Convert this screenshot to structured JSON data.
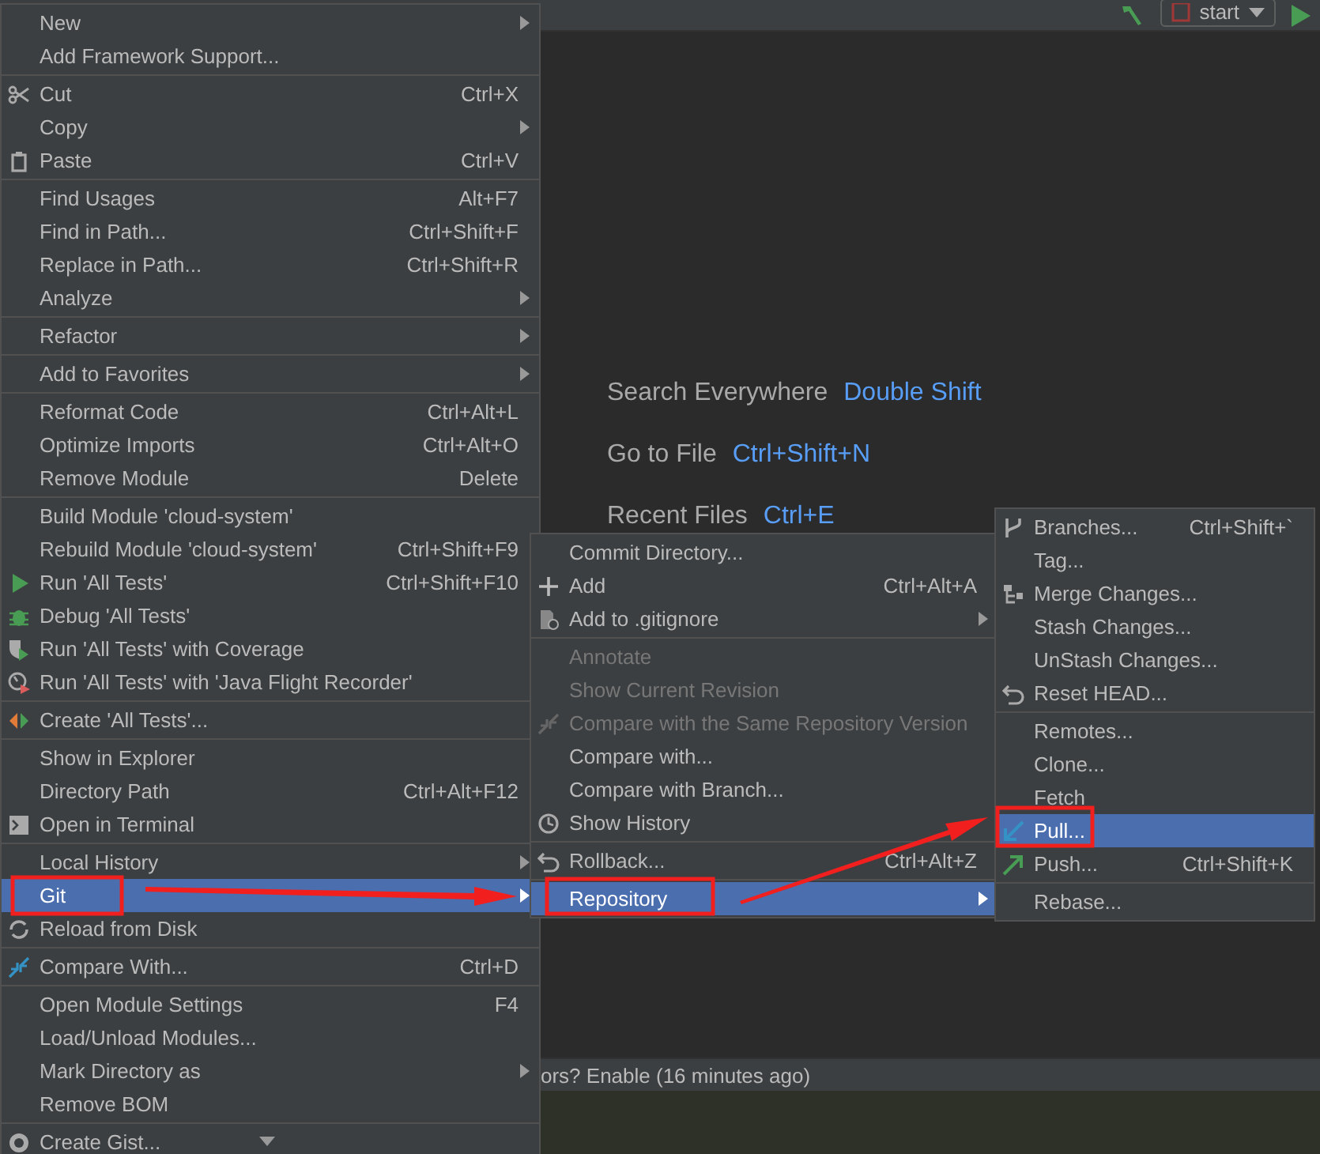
{
  "toolbar": {
    "run_configuration": "start"
  },
  "editor_hints": [
    {
      "action": "Search Everywhere",
      "shortcut": "Double Shift"
    },
    {
      "action": "Go to File",
      "shortcut": "Ctrl+Shift+N"
    },
    {
      "action": "Recent Files",
      "shortcut": "Ctrl+E"
    }
  ],
  "status_bar": {
    "text": "ors? Enable (16 minutes ago)"
  },
  "menus": [
    {
      "sections": [
        [
          {
            "label": "New",
            "submenu": true,
            "selected": false,
            "disabled": false
          },
          {
            "label": "Add Framework Support...",
            "submenu": false,
            "selected": false,
            "disabled": false
          }
        ],
        [
          {
            "label": "Cut",
            "shortcut": "Ctrl+X",
            "submenu": false,
            "selected": false,
            "disabled": false
          },
          {
            "label": "Copy",
            "submenu": true,
            "selected": false,
            "disabled": false
          },
          {
            "label": "Paste",
            "shortcut": "Ctrl+V",
            "submenu": false,
            "selected": false,
            "disabled": false
          }
        ],
        [
          {
            "label": "Find Usages",
            "shortcut": "Alt+F7",
            "submenu": false,
            "selected": false,
            "disabled": false
          },
          {
            "label": "Find in Path...",
            "shortcut": "Ctrl+Shift+F",
            "submenu": false,
            "selected": false,
            "disabled": false
          },
          {
            "label": "Replace in Path...",
            "shortcut": "Ctrl+Shift+R",
            "submenu": false,
            "selected": false,
            "disabled": false
          },
          {
            "label": "Analyze",
            "submenu": true,
            "selected": false,
            "disabled": false
          }
        ],
        [
          {
            "label": "Refactor",
            "submenu": true,
            "selected": false,
            "disabled": false
          }
        ],
        [
          {
            "label": "Add to Favorites",
            "submenu": true,
            "selected": false,
            "disabled": false
          }
        ],
        [
          {
            "label": "Reformat Code",
            "shortcut": "Ctrl+Alt+L",
            "submenu": false,
            "selected": false,
            "disabled": false
          },
          {
            "label": "Optimize Imports",
            "shortcut": "Ctrl+Alt+O",
            "submenu": false,
            "selected": false,
            "disabled": false
          },
          {
            "label": "Remove Module",
            "shortcut": "Delete",
            "submenu": false,
            "selected": false,
            "disabled": false
          }
        ],
        [
          {
            "label": "Build Module 'cloud-system'",
            "submenu": false,
            "selected": false,
            "disabled": false
          },
          {
            "label": "Rebuild Module 'cloud-system'",
            "shortcut": "Ctrl+Shift+F9",
            "submenu": false,
            "selected": false,
            "disabled": false
          },
          {
            "label": "Run 'All Tests'",
            "shortcut": "Ctrl+Shift+F10",
            "submenu": false,
            "selected": false,
            "disabled": false
          },
          {
            "label": "Debug 'All Tests'",
            "submenu": false,
            "selected": false,
            "disabled": false
          },
          {
            "label": "Run 'All Tests' with Coverage",
            "submenu": false,
            "selected": false,
            "disabled": false
          },
          {
            "label": "Run 'All Tests' with 'Java Flight Recorder'",
            "submenu": false,
            "selected": false,
            "disabled": false
          }
        ],
        [
          {
            "label": "Create 'All Tests'...",
            "submenu": false,
            "selected": false,
            "disabled": false
          }
        ],
        [
          {
            "label": "Show in Explorer",
            "submenu": false,
            "selected": false,
            "disabled": false
          },
          {
            "label": "Directory Path",
            "shortcut": "Ctrl+Alt+F12",
            "submenu": false,
            "selected": false,
            "disabled": false
          },
          {
            "label": "Open in Terminal",
            "submenu": false,
            "selected": false,
            "disabled": false
          }
        ],
        [
          {
            "label": "Local History",
            "submenu": true,
            "selected": false,
            "disabled": false
          },
          {
            "label": "Git",
            "submenu": true,
            "selected": true,
            "disabled": false
          },
          {
            "label": "Reload from Disk",
            "submenu": false,
            "selected": false,
            "disabled": false
          }
        ],
        [
          {
            "label": "Compare With...",
            "shortcut": "Ctrl+D",
            "submenu": false,
            "selected": false,
            "disabled": false
          }
        ],
        [
          {
            "label": "Open Module Settings",
            "shortcut": "F4",
            "submenu": false,
            "selected": false,
            "disabled": false
          },
          {
            "label": "Load/Unload Modules...",
            "submenu": false,
            "selected": false,
            "disabled": false
          },
          {
            "label": "Mark Directory as",
            "submenu": true,
            "selected": false,
            "disabled": false
          },
          {
            "label": "Remove BOM",
            "submenu": false,
            "selected": false,
            "disabled": false
          }
        ],
        [
          {
            "label": "Create Gist...",
            "submenu": false,
            "selected": false,
            "disabled": false
          }
        ]
      ]
    },
    {
      "sections": [
        [
          {
            "label": "Commit Directory...",
            "submenu": false,
            "selected": false,
            "disabled": false
          },
          {
            "label": "Add",
            "shortcut": "Ctrl+Alt+A",
            "submenu": false,
            "selected": false,
            "disabled": false
          },
          {
            "label": "Add to .gitignore",
            "submenu": true,
            "selected": false,
            "disabled": false
          }
        ],
        [
          {
            "label": "Annotate",
            "submenu": false,
            "selected": false,
            "disabled": true
          },
          {
            "label": "Show Current Revision",
            "submenu": false,
            "selected": false,
            "disabled": true
          },
          {
            "label": "Compare with the Same Repository Version",
            "submenu": false,
            "selected": false,
            "disabled": true
          },
          {
            "label": "Compare with...",
            "submenu": false,
            "selected": false,
            "disabled": false
          },
          {
            "label": "Compare with Branch...",
            "submenu": false,
            "selected": false,
            "disabled": false
          },
          {
            "label": "Show History",
            "submenu": false,
            "selected": false,
            "disabled": false
          }
        ],
        [
          {
            "label": "Rollback...",
            "shortcut": "Ctrl+Alt+Z",
            "submenu": false,
            "selected": false,
            "disabled": false
          }
        ],
        [
          {
            "label": "Repository",
            "submenu": true,
            "selected": true,
            "disabled": false
          }
        ]
      ]
    },
    {
      "sections": [
        [
          {
            "label": "Branches...",
            "shortcut": "Ctrl+Shift+`",
            "submenu": false,
            "selected": false,
            "disabled": false
          },
          {
            "label": "Tag...",
            "submenu": false,
            "selected": false,
            "disabled": false
          },
          {
            "label": "Merge Changes...",
            "submenu": false,
            "selected": false,
            "disabled": false
          },
          {
            "label": "Stash Changes...",
            "submenu": false,
            "selected": false,
            "disabled": false
          },
          {
            "label": "UnStash Changes...",
            "submenu": false,
            "selected": false,
            "disabled": false
          },
          {
            "label": "Reset HEAD...",
            "submenu": false,
            "selected": false,
            "disabled": false
          }
        ],
        [
          {
            "label": "Remotes...",
            "submenu": false,
            "selected": false,
            "disabled": false
          },
          {
            "label": "Clone...",
            "submenu": false,
            "selected": false,
            "disabled": false
          },
          {
            "label": "Fetch",
            "submenu": false,
            "selected": false,
            "disabled": false
          },
          {
            "label": "Pull...",
            "submenu": false,
            "selected": true,
            "disabled": false
          },
          {
            "label": "Push...",
            "shortcut": "Ctrl+Shift+K",
            "submenu": false,
            "selected": false,
            "disabled": false
          }
        ],
        [
          {
            "label": "Rebase...",
            "submenu": false,
            "selected": false,
            "disabled": false
          }
        ]
      ]
    }
  ]
}
